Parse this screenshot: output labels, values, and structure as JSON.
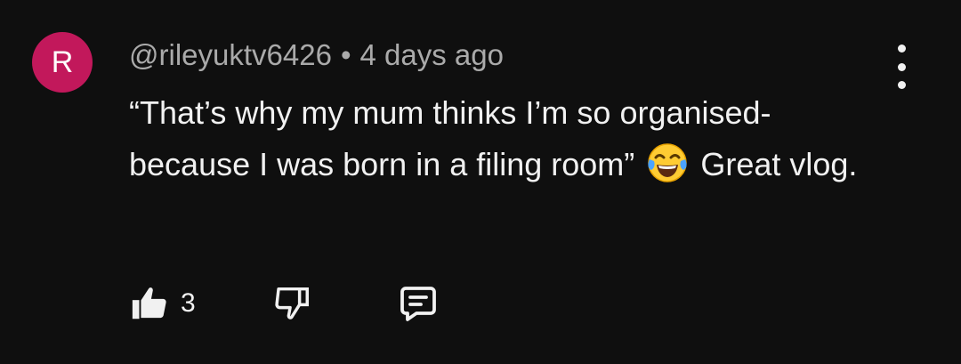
{
  "colors": {
    "background": "#0f0f0f",
    "avatar_bg": "#c2185b",
    "text_primary": "#f1f1f1",
    "text_secondary": "#aaaaaa"
  },
  "comment": {
    "avatar_letter": "R",
    "author": "@rileyuktv6426",
    "separator": "•",
    "timestamp": "4 days ago",
    "text_before_emoji": "“That’s why my mum thinks I’m so organised- because I was born in a filing room”",
    "emoji": "face-with-tears-of-joy",
    "text_after_emoji": "Great vlog."
  },
  "actions": {
    "like_icon": "thumbs-up-filled-icon",
    "like_count": "3",
    "dislike_icon": "thumbs-down-outline-icon",
    "reply_icon": "comment-reply-icon",
    "more_icon": "more-vertical-icon"
  }
}
